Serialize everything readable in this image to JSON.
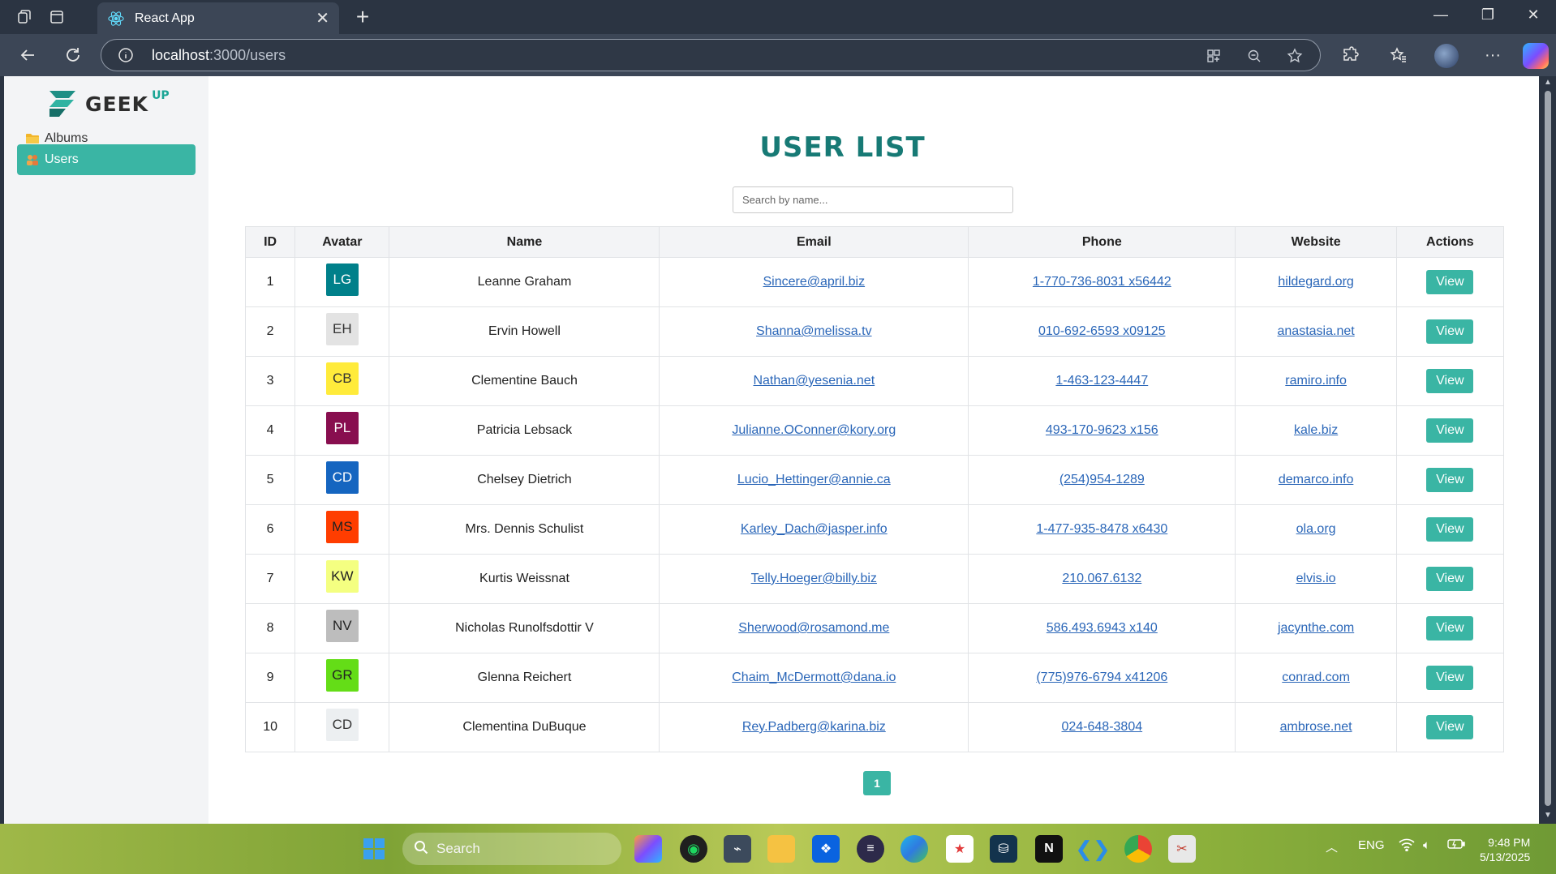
{
  "browser": {
    "tab_title": "React App",
    "url_host": "localhost",
    "url_path": ":3000/users"
  },
  "sidebar": {
    "logo_text": "GEEK",
    "logo_sup": "UP",
    "items": [
      {
        "label": "Albums",
        "icon": "folder-icon",
        "active": false
      },
      {
        "label": "Users",
        "icon": "users-icon",
        "active": true
      }
    ]
  },
  "main": {
    "title": "USER LIST",
    "search_placeholder": "Search by name...",
    "columns": [
      "ID",
      "Avatar",
      "Name",
      "Email",
      "Phone",
      "Website",
      "Actions"
    ],
    "rows": [
      {
        "id": "1",
        "initials": "LG",
        "avatar_bg": "#00808a",
        "avatar_fg": "#ffffff",
        "name": "Leanne Graham",
        "email": "Sincere@april.biz",
        "phone": "1-770-736-8031 x56442",
        "website": "hildegard.org",
        "action": "View"
      },
      {
        "id": "2",
        "initials": "EH",
        "avatar_bg": "#e3e3e3",
        "avatar_fg": "#333333",
        "name": "Ervin Howell",
        "email": "Shanna@melissa.tv",
        "phone": "010-692-6593 x09125",
        "website": "anastasia.net",
        "action": "View"
      },
      {
        "id": "3",
        "initials": "CB",
        "avatar_bg": "#ffeb3b",
        "avatar_fg": "#333333",
        "name": "Clementine Bauch",
        "email": "Nathan@yesenia.net",
        "phone": "1-463-123-4447",
        "website": "ramiro.info",
        "action": "View"
      },
      {
        "id": "4",
        "initials": "PL",
        "avatar_bg": "#880e4f",
        "avatar_fg": "#ffffff",
        "name": "Patricia Lebsack",
        "email": "Julianne.OConner@kory.org",
        "phone": "493-170-9623 x156",
        "website": "kale.biz",
        "action": "View"
      },
      {
        "id": "5",
        "initials": "CD",
        "avatar_bg": "#1565c0",
        "avatar_fg": "#ffffff",
        "name": "Chelsey Dietrich",
        "email": "Lucio_Hettinger@annie.ca",
        "phone": "(254)954-1289",
        "website": "demarco.info",
        "action": "View"
      },
      {
        "id": "6",
        "initials": "MS",
        "avatar_bg": "#ff3d00",
        "avatar_fg": "#222222",
        "name": "Mrs. Dennis Schulist",
        "email": "Karley_Dach@jasper.info",
        "phone": "1-477-935-8478 x6430",
        "website": "ola.org",
        "action": "View"
      },
      {
        "id": "7",
        "initials": "KW",
        "avatar_bg": "#f4ff81",
        "avatar_fg": "#222222",
        "name": "Kurtis Weissnat",
        "email": "Telly.Hoeger@billy.biz",
        "phone": "210.067.6132",
        "website": "elvis.io",
        "action": "View"
      },
      {
        "id": "8",
        "initials": "NV",
        "avatar_bg": "#bdbdbd",
        "avatar_fg": "#222222",
        "name": "Nicholas Runolfsdottir V",
        "email": "Sherwood@rosamond.me",
        "phone": "586.493.6943 x140",
        "website": "jacynthe.com",
        "action": "View"
      },
      {
        "id": "9",
        "initials": "GR",
        "avatar_bg": "#64dd17",
        "avatar_fg": "#222222",
        "name": "Glenna Reichert",
        "email": "Chaim_McDermott@dana.io",
        "phone": "(775)976-6794 x41206",
        "website": "conrad.com",
        "action": "View"
      },
      {
        "id": "10",
        "initials": "CD",
        "avatar_bg": "#eceff1",
        "avatar_fg": "#333333",
        "name": "Clementina DuBuque",
        "email": "Rey.Padberg@karina.biz",
        "phone": "024-648-3804",
        "website": "ambrose.net",
        "action": "View"
      }
    ],
    "pagination": {
      "current": "1"
    }
  },
  "taskbar": {
    "search_label": "Search",
    "lang": "ENG",
    "time": "9:48 PM",
    "date": "5/13/2025"
  },
  "colors": {
    "accent": "#3ab5a4",
    "title": "#177a75",
    "link": "#2a66b8"
  }
}
